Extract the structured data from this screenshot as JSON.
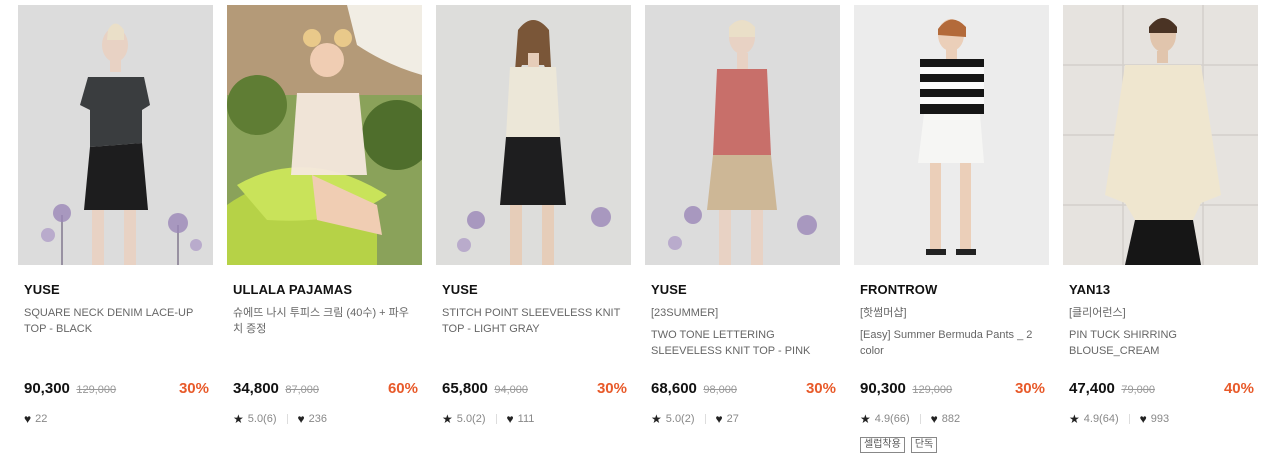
{
  "products": [
    {
      "brand": "YUSE",
      "tag": "",
      "name": "SQUARE NECK DENIM LACE-UP TOP - BLACK",
      "price": "90,300",
      "original_price": "129,000",
      "discount": "30%",
      "rating": "",
      "likes": "22",
      "badges": [],
      "image_bg": "#dcdcdc"
    },
    {
      "brand": "ULLALA PAJAMAS",
      "tag": "",
      "name": "슈에뜨 나시 투피스 크림 (40수) + 파우치 증정",
      "price": "34,800",
      "original_price": "87,000",
      "discount": "60%",
      "rating": "5.0(6)",
      "likes": "236",
      "badges": [],
      "image_bg": "#9ab36a"
    },
    {
      "brand": "YUSE",
      "tag": "",
      "name": "STITCH POINT SLEEVELESS KNIT TOP - LIGHT GRAY",
      "price": "65,800",
      "original_price": "94,000",
      "discount": "30%",
      "rating": "5.0(2)",
      "likes": "111",
      "badges": [],
      "image_bg": "#dddddb"
    },
    {
      "brand": "YUSE",
      "tag": "[23SUMMER]",
      "name": "TWO TONE LETTERING SLEEVELESS KNIT TOP - PINK",
      "price": "68,600",
      "original_price": "98,000",
      "discount": "30%",
      "rating": "5.0(2)",
      "likes": "27",
      "badges": [],
      "image_bg": "#dcdcdc"
    },
    {
      "brand": "FRONTROW",
      "tag": "[핫썸머샵]",
      "name": "[Easy] Summer Bermuda Pants _ 2 color",
      "price": "90,300",
      "original_price": "129,000",
      "discount": "30%",
      "rating": "4.9(66)",
      "likes": "882",
      "badges": [
        "셀럽착용",
        "단독"
      ],
      "image_bg": "#ececec"
    },
    {
      "brand": "YAN13",
      "tag": "[클리어런스]",
      "name": "PIN TUCK SHIRRING BLOUSE_CREAM",
      "price": "47,400",
      "original_price": "79,000",
      "discount": "40%",
      "rating": "4.9(64)",
      "likes": "993",
      "badges": [],
      "image_bg": "#e6e3df"
    }
  ],
  "icons": {
    "star": "star-icon",
    "heart": "heart-icon"
  },
  "colors": {
    "discount": "#e85a2a",
    "text": "#111111",
    "muted": "#888888"
  }
}
